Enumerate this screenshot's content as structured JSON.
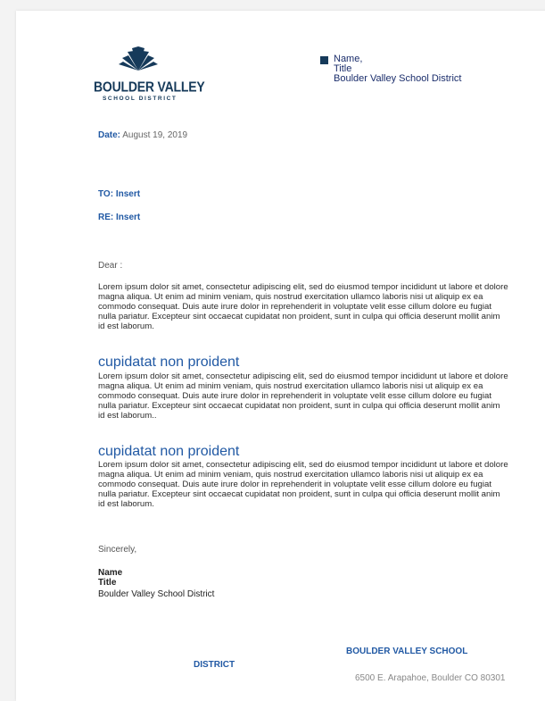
{
  "header": {
    "logo": {
      "name": "BOULDER VALLEY",
      "subtitle": "SCHOOL DISTRICT"
    },
    "sender": {
      "name": "Name,",
      "title": "Title",
      "org": "Boulder Valley School District"
    }
  },
  "letter": {
    "date_label": "Date:",
    "date_value": "August 19, 2019",
    "to": "TO: Insert",
    "re": "RE: Insert",
    "greeting": "Dear :",
    "paragraph1": "Lorem ipsum dolor sit amet, consectetur adipiscing elit, sed do eiusmod tempor incididunt ut labore et dolore magna aliqua. Ut enim ad minim veniam, quis nostrud exercitation ullamco laboris nisi ut aliquip ex ea commodo consequat. Duis aute irure dolor in reprehenderit in voluptate velit esse cillum dolore eu fugiat nulla pariatur. Excepteur sint occaecat cupidatat non proident, sunt in culpa qui officia deserunt mollit anim id est laborum.",
    "heading1": "cupidatat non proident",
    "paragraph2": "Lorem ipsum dolor sit amet, consectetur adipiscing elit, sed do eiusmod tempor incididunt ut labore et dolore magna aliqua. Ut enim ad minim veniam, quis nostrud exercitation ullamco laboris nisi ut aliquip ex ea commodo consequat. Duis aute irure dolor in reprehenderit in voluptate velit esse cillum dolore eu fugiat nulla pariatur. Excepteur sint occaecat cupidatat non proident, sunt in culpa qui officia deserunt mollit anim id est laborum..",
    "heading2": "cupidatat non proident",
    "paragraph3": "Lorem ipsum dolor sit amet, consectetur adipiscing elit, sed do eiusmod tempor incididunt ut labore et dolore magna aliqua. Ut enim ad minim veniam, quis nostrud exercitation ullamco laboris nisi ut aliquip ex ea commodo consequat. Duis aute irure dolor in reprehenderit in voluptate velit esse cillum dolore eu fugiat nulla pariatur. Excepteur sint occaecat cupidatat non proident, sunt in culpa qui officia deserunt mollit anim id est laborum.",
    "closing": "Sincerely,",
    "signature": {
      "name": "Name",
      "title": "Title",
      "org": "Boulder Valley School District"
    }
  },
  "footer": {
    "line1": "BOULDER VALLEY SCHOOL",
    "line2": "DISTRICT",
    "address": "6500 E. Arapahoe, Boulder CO 80301"
  },
  "colors": {
    "navy": "#163a5a",
    "accent_blue": "#2159a4",
    "sender_blue": "#1a2d6b"
  }
}
